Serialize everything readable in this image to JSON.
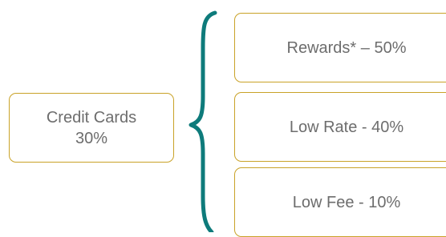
{
  "diagram": {
    "colors": {
      "box_border": "#c9a227",
      "brace": "#0e7b7b",
      "text": "#6d6d6d"
    },
    "parent": {
      "line1": "Credit Cards",
      "line2": "30%"
    },
    "children": [
      {
        "label": "Rewards* – 50%"
      },
      {
        "label": "Low Rate -  40%"
      },
      {
        "label": "Low Fee -  10%"
      }
    ]
  }
}
